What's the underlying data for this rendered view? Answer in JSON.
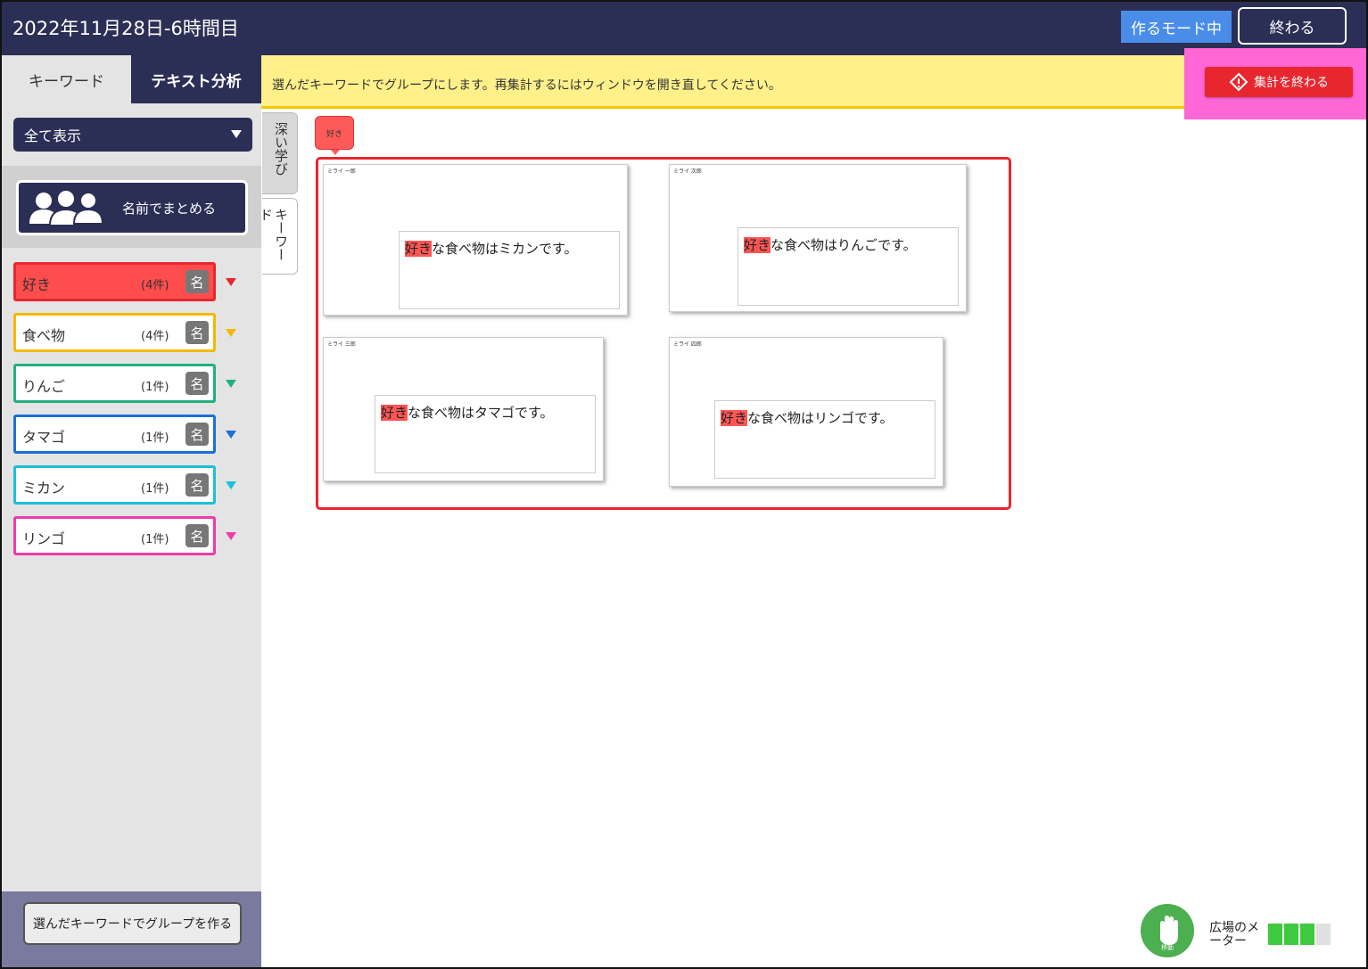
{
  "header": {
    "title": "2022年11月28日-6時間目",
    "mode_label": "作るモード中",
    "end_label": "終わる"
  },
  "tabs": {
    "keyword": "キーワード",
    "text_analysis": "テキスト分析"
  },
  "notice": {
    "text": "選んだキーワードでグループにします。再集計するにはウィンドウを開き直してください。",
    "finish_label": "集計を終わる"
  },
  "sidebar": {
    "filter_value": "全て表示",
    "group_by_name_label": "名前でまとめる",
    "name_badge": "名",
    "keywords": [
      {
        "label": "好き",
        "count": "(4件)",
        "color": "#e8262e",
        "filled": true
      },
      {
        "label": "食べ物",
        "count": "(4件)",
        "color": "#f5b800",
        "filled": false
      },
      {
        "label": "りんご",
        "count": "(1件)",
        "color": "#22b07d",
        "filled": false
      },
      {
        "label": "タマゴ",
        "count": "(1件)",
        "color": "#1e6fd9",
        "filled": false
      },
      {
        "label": "ミカン",
        "count": "(1件)",
        "color": "#1cc0d8",
        "filled": false
      },
      {
        "label": "リンゴ",
        "count": "(1件)",
        "color": "#f03aa8",
        "filled": false
      }
    ],
    "make_group_label": "選んだキーワードでグループを作る"
  },
  "side_tabs": {
    "deep_learning": "深い学び",
    "keyword": "キーワード"
  },
  "canvas": {
    "group_tag": "好き",
    "cards": [
      {
        "author": "ミライ 一郎",
        "highlight": "好き",
        "rest": "な食べ物はミカンです。"
      },
      {
        "author": "ミライ 次郎",
        "highlight": "好き",
        "rest": "な食べ物はりんごです。"
      },
      {
        "author": "ミライ 三郎",
        "highlight": "好き",
        "rest": "な食べ物はタマゴです。"
      },
      {
        "author": "ミライ 四郎",
        "highlight": "好き",
        "rest": "な食べ物はリンゴです。"
      }
    ]
  },
  "footer": {
    "hand_label": "移動",
    "meter_label": "広場のメーター",
    "meter_level": 0.75,
    "meter_colors": [
      "#3fc93f",
      "#3fc93f",
      "#3fc93f",
      "#e0e0e0"
    ]
  }
}
